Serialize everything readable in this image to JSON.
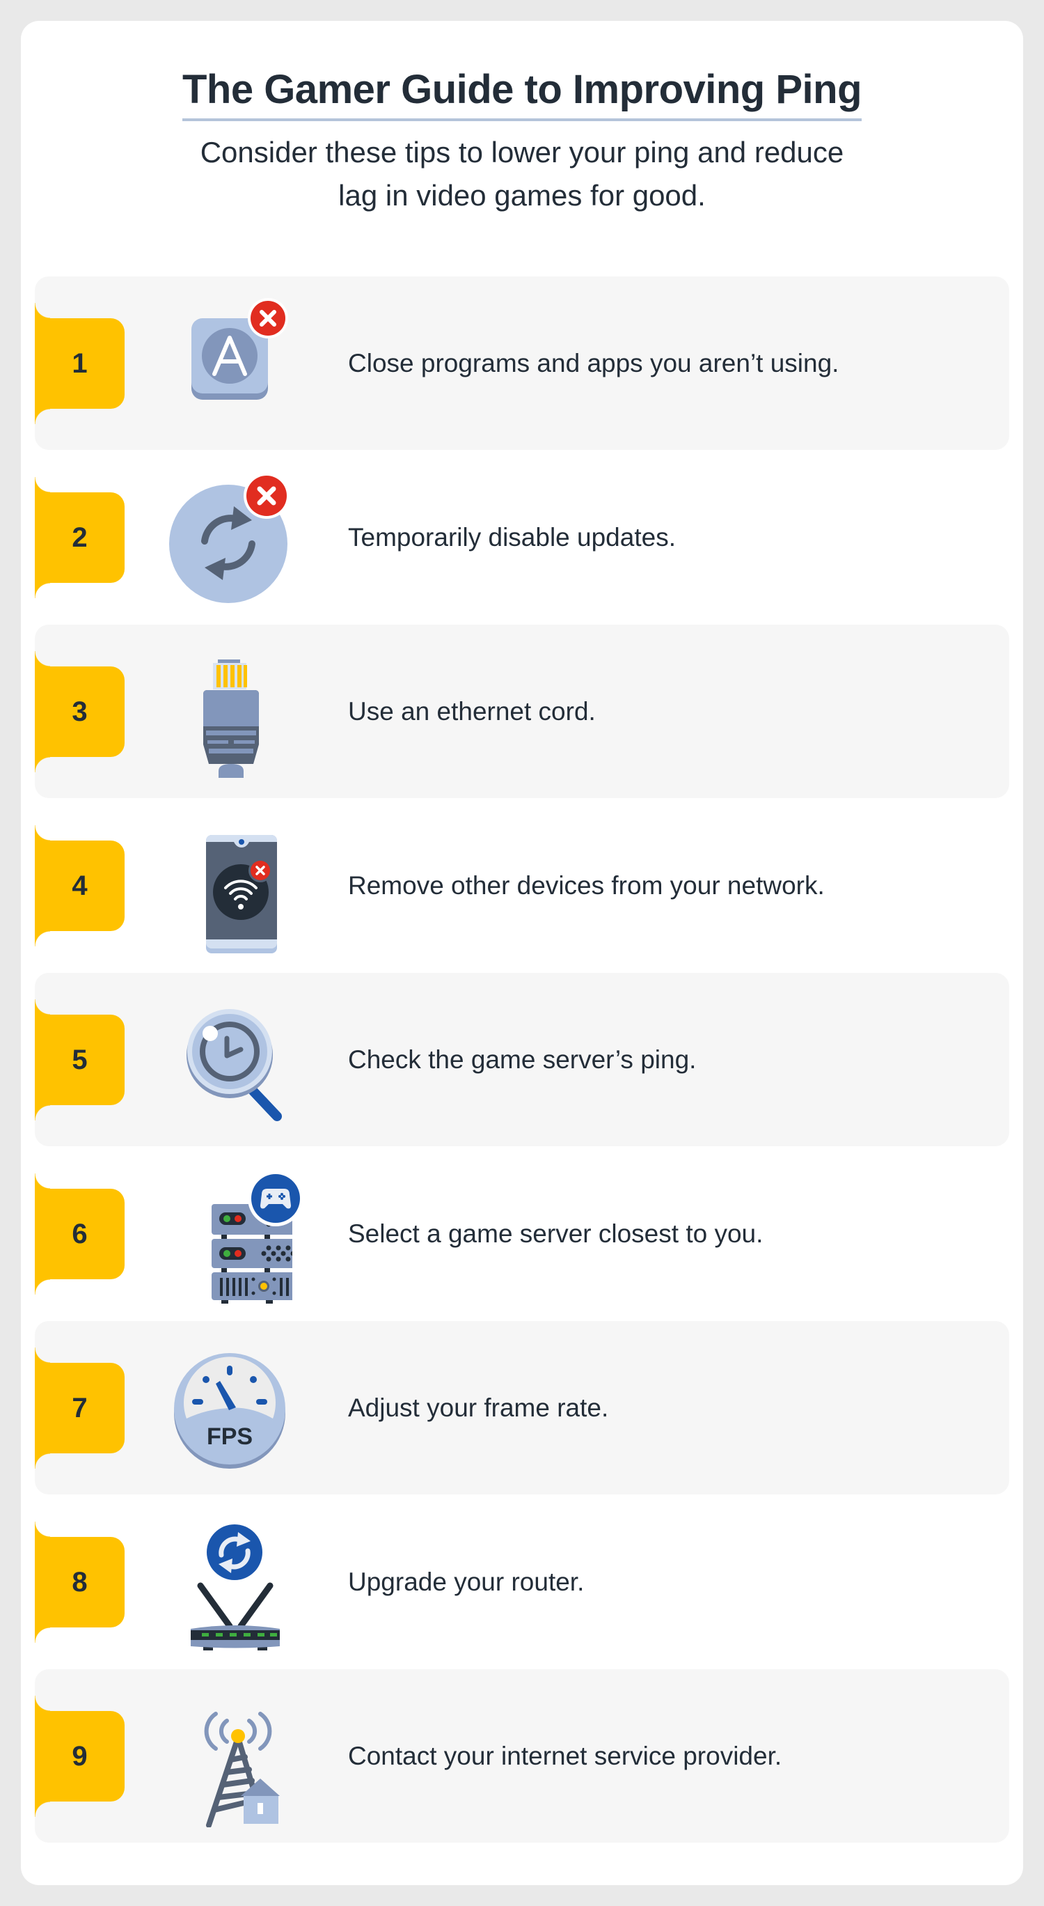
{
  "title": "The Gamer Guide to Improving Ping",
  "subtitle": {
    "line1": "Consider these tips to lower your ping and reduce",
    "line2": "lag in video games for good."
  },
  "colors": {
    "badge": "#ffc200",
    "text": "#232d38",
    "row_shaded": "#f6f6f6",
    "icon_light": "#afc3e2",
    "icon_mid": "#8296bb",
    "icon_dark": "#556276",
    "accent_blue": "#1a56ad",
    "alert_red": "#e12d20"
  },
  "tips": [
    {
      "number": "1",
      "text": "Close programs and apps you aren’t using.",
      "icon": "app-close-icon"
    },
    {
      "number": "2",
      "text": "Temporarily disable updates.",
      "icon": "updates-disabled-icon"
    },
    {
      "number": "3",
      "text": "Use an ethernet cord.",
      "icon": "ethernet-cable-icon"
    },
    {
      "number": "4",
      "text": "Remove other devices from your network.",
      "icon": "phone-wifi-off-icon"
    },
    {
      "number": "5",
      "text": "Check the game server’s ping.",
      "icon": "magnifier-clock-icon"
    },
    {
      "number": "6",
      "text": "Select a game server closest to you.",
      "icon": "server-gamepad-icon"
    },
    {
      "number": "7",
      "text": "Adjust your frame rate.",
      "icon": "fps-gauge-icon",
      "icon_label": "FPS"
    },
    {
      "number": "8",
      "text": "Upgrade your router.",
      "icon": "router-refresh-icon"
    },
    {
      "number": "9",
      "text": "Contact your internet service provider.",
      "icon": "cell-tower-icon"
    }
  ]
}
